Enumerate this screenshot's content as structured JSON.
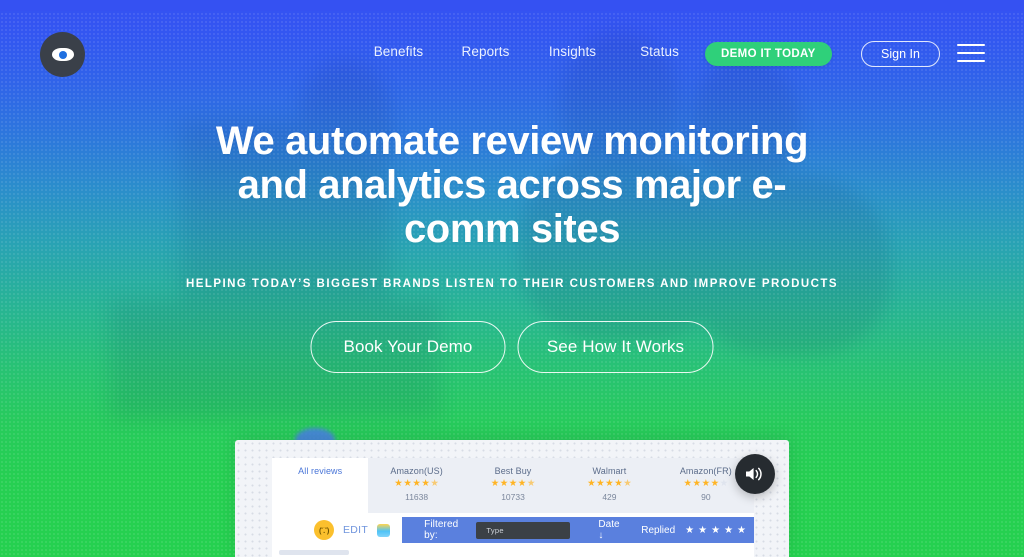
{
  "brand": {
    "logo_icon": "eye-icon",
    "accent_green": "#2fd07a",
    "accent_blue": "#3551f2"
  },
  "nav": {
    "links": [
      {
        "label": "Benefits"
      },
      {
        "label": "Reports"
      },
      {
        "label": "Insights"
      },
      {
        "label": "Status"
      }
    ],
    "demo_button": "DEMO IT TODAY",
    "signin_button": "Sign In",
    "menu_icon": "hamburger-menu-icon"
  },
  "hero": {
    "headline": "We automate review monitoring and analytics across major e-comm sites",
    "subheadline": "HELPING TODAY’S BIGGEST BRANDS LISTEN TO THEIR CUSTOMERS AND IMPROVE PRODUCTS",
    "cta_primary": "Book Your Demo",
    "cta_secondary": "See How It Works"
  },
  "preview": {
    "sound_icon": "speaker-volume-icon",
    "tabs": [
      {
        "label": "All reviews",
        "stars_full": 0,
        "stars_half": 0,
        "stars_empty": 0,
        "count": "",
        "active": true
      },
      {
        "label": "Amazon(US)",
        "stars_full": 4,
        "stars_half": 1,
        "stars_empty": 0,
        "count": "11638",
        "active": false
      },
      {
        "label": "Best Buy",
        "stars_full": 4,
        "stars_half": 1,
        "stars_empty": 0,
        "count": "10733",
        "active": false
      },
      {
        "label": "Walmart",
        "stars_full": 4,
        "stars_half": 1,
        "stars_empty": 0,
        "count": "429",
        "active": false
      },
      {
        "label": "Amazon(FR)",
        "stars_full": 4,
        "stars_half": 0,
        "stars_empty": 1,
        "count": "90",
        "active": false
      }
    ],
    "toolbar": {
      "mood_emoji": "neutral-face-emoji",
      "edit_label": "EDIT",
      "tag_emoji": "sticker-emoji",
      "filtered_by_label": "Filtered by:",
      "type_value": "Type",
      "date_label": "Date ↓",
      "replied_label": "Replied",
      "rating_stars": 5
    }
  }
}
